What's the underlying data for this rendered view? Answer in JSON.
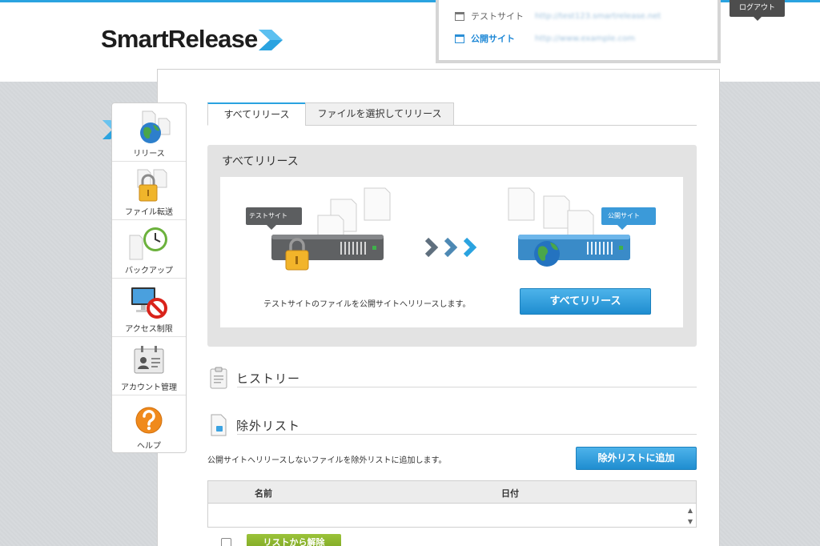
{
  "brand": {
    "name": "SmartRelease",
    "accent": "#2aa3e0"
  },
  "sites": {
    "test": {
      "label": "テストサイト",
      "url": "http://test123.smartrelease.net"
    },
    "public": {
      "label": "公開サイト",
      "url": "http://www.example.com"
    }
  },
  "header": {
    "logout_label": "ログアウト"
  },
  "sidebar": {
    "items": [
      {
        "label": "リリース",
        "icon": "globe-icon"
      },
      {
        "label": "ファイル転送",
        "icon": "lock-icon"
      },
      {
        "label": "バックアップ",
        "icon": "clock-icon"
      },
      {
        "label": "アクセス制限",
        "icon": "no-entry-icon"
      },
      {
        "label": "アカウント管理",
        "icon": "id-card-icon"
      },
      {
        "label": "ヘルプ",
        "icon": "help-icon"
      }
    ]
  },
  "tabs": [
    {
      "label": "すべてリリース",
      "active": true
    },
    {
      "label": "ファイルを選択してリリース",
      "active": false
    }
  ],
  "release": {
    "title": "すべてリリース",
    "test_tag": "テストサイト",
    "public_tag": "公開サイト",
    "description": "テストサイトのファイルを公開サイトへリリースします。",
    "button_label": "すべてリリース"
  },
  "history": {
    "title": "ヒストリー"
  },
  "exclusion": {
    "title": "除外リスト",
    "description": "公開サイトへリリースしないファイルを除外リストに追加します。",
    "add_button_label": "除外リストに追加",
    "columns": [
      "名前",
      "日付"
    ],
    "remove_button_label": "リストから解除"
  }
}
